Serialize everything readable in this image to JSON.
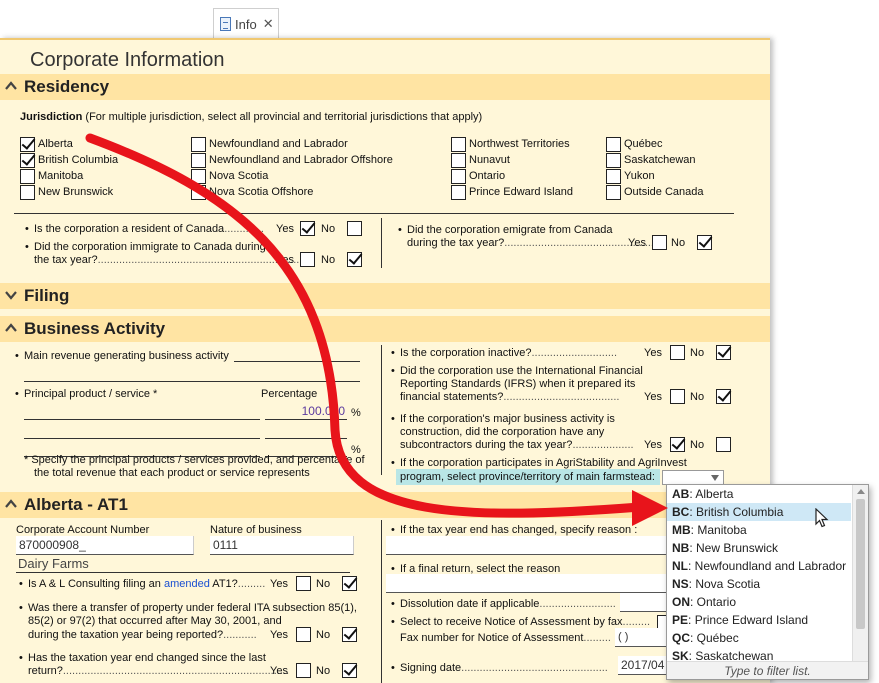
{
  "tab": {
    "label": "Info"
  },
  "page_title": "Corporate Information",
  "residency": {
    "header": "Residency",
    "jurisdiction_label": "Jurisdiction",
    "jurisdiction_hint": "(For multiple jurisdiction, select all provincial and territorial jurisdictions that apply)",
    "provinces": [
      {
        "name": "Alberta",
        "checked": true
      },
      {
        "name": "British Columbia",
        "checked": true
      },
      {
        "name": "Manitoba",
        "checked": false
      },
      {
        "name": "New Brunswick",
        "checked": false
      },
      {
        "name": "Newfoundland and Labrador",
        "checked": false
      },
      {
        "name": "Newfoundland and Labrador Offshore",
        "checked": false
      },
      {
        "name": "Nova Scotia",
        "checked": false
      },
      {
        "name": "Nova Scotia Offshore",
        "checked": false
      },
      {
        "name": "Northwest Territories",
        "checked": false
      },
      {
        "name": "Nunavut",
        "checked": false
      },
      {
        "name": "Ontario",
        "checked": false
      },
      {
        "name": "Prince Edward Island",
        "checked": false
      },
      {
        "name": "Québec",
        "checked": false
      },
      {
        "name": "Saskatchewan",
        "checked": false
      },
      {
        "name": "Yukon",
        "checked": false
      },
      {
        "name": "Outside Canada",
        "checked": false
      }
    ],
    "q_resident": "Is the corporation a resident of Canada",
    "q_immigrate_1": "Did the corporation immigrate to Canada during",
    "q_immigrate_2": "the tax year?",
    "q_emigrate_1": "Did the corporation emigrate from Canada",
    "q_emigrate_2": "during the tax year?"
  },
  "yes": "Yes",
  "no": "No",
  "filing": {
    "header": "Filing"
  },
  "business": {
    "header": "Business Activity",
    "main_revenue": "Main revenue generating business activity",
    "principal_product": "Principal product / service *",
    "percentage": "Percentage",
    "percentage_value": "100.000",
    "percent_sign": "%",
    "note_1": "* Specify the principal products / services provided, and percentage of",
    "note_2": "the total revenue that each product or service represents",
    "q_inactive": "Is the corporation inactive?",
    "q_ifrs_1": "Did the corporation use the International Financial",
    "q_ifrs_2": "Reporting Standards (IFRS) when it prepared its",
    "q_ifrs_3": "financial statements?",
    "q_construction_1": "If the corporation's major business activity is",
    "q_construction_2": "construction, did the corporation have any",
    "q_construction_3": "subcontractors during the tax year?",
    "q_agri_1": "If the corporation participates in AgriStability and AgriInvest",
    "q_agri_2": "program, select province/territory of main farmstead:"
  },
  "alberta": {
    "header": "Alberta - AT1",
    "corp_account_label": "Corporate Account Number",
    "corp_account_value": "870000908_",
    "nature_label": "Nature of business",
    "nature_value": "0111",
    "business_name": "Dairy Farms",
    "q_filing_pre": "Is A & L Consulting filing an",
    "q_filing_link": "amended",
    "q_filing_post": "AT1?",
    "q_transfer_1": "Was there a transfer of property under federal ITA subsection 85(1),",
    "q_transfer_2": "85(2) or 97(2) that occurred after May 30, 2001, and",
    "q_transfer_3": "during the taxation year being reported?",
    "q_yearend_1": "Has the taxation year end changed since the last",
    "q_yearend_2": "return?",
    "q_yearend_reason": "If the tax year end has changed, specify reason :",
    "q_final_return": "If a final return, select the reason",
    "dissolution": "Dissolution date if applicable",
    "notice_fax": "Select to receive Notice of Assessment by fax",
    "fax_number": "Fax number for Notice of Assessment",
    "fax_value": "(    )",
    "signing_date": "Signing date",
    "signing_value": "2017/04"
  },
  "dropdown": {
    "items": [
      {
        "code": "AB",
        "name": "Alberta"
      },
      {
        "code": "BC",
        "name": "British Columbia"
      },
      {
        "code": "MB",
        "name": "Manitoba"
      },
      {
        "code": "NB",
        "name": "New Brunswick"
      },
      {
        "code": "NL",
        "name": "Newfoundland and Labrador"
      },
      {
        "code": "NS",
        "name": "Nova Scotia"
      },
      {
        "code": "ON",
        "name": "Ontario"
      },
      {
        "code": "PE",
        "name": "Prince Edward Island"
      },
      {
        "code": "QC",
        "name": "Québec"
      },
      {
        "code": "SK",
        "name": "Saskatchewan"
      }
    ],
    "selected_code": "BC",
    "hint": "Type to filter list."
  },
  "colors": {
    "page_bg": "#fff7d9",
    "section_header": "#ffe4a3",
    "highlight_arrow": "#e8141b",
    "dropdown_selected": "#cfe8f6"
  }
}
